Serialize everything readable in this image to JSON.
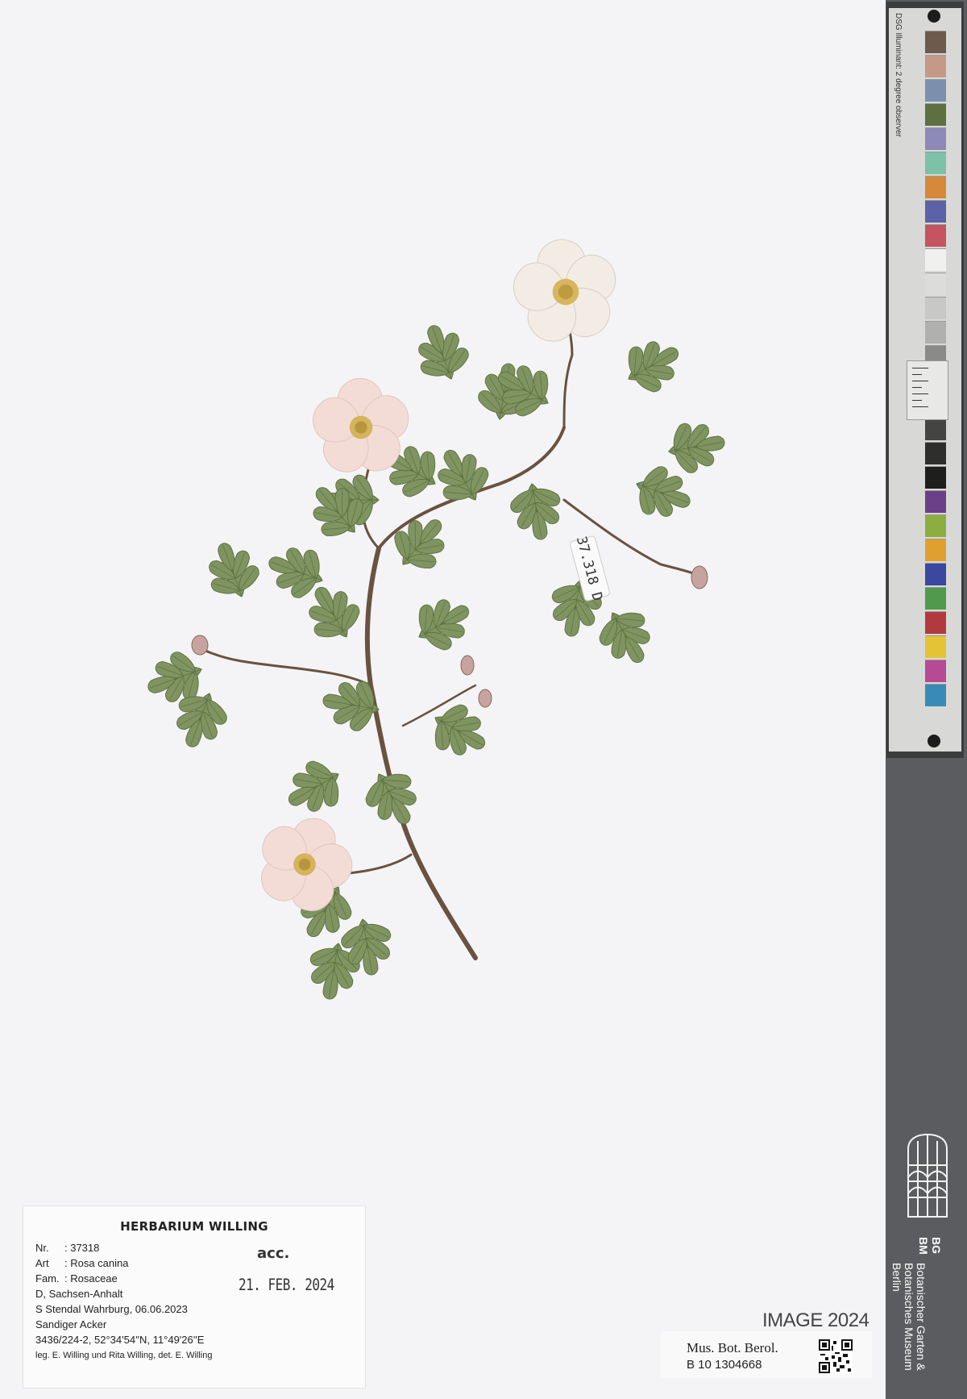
{
  "specimen_label": {
    "heading": "HERBARIUM WILLING",
    "nr_key": "Nr.",
    "nr_value": ": 37318",
    "art_key": "Art",
    "art_value": ": Rosa canina",
    "fam_key": "Fam.",
    "fam_value": ": Rosaceae",
    "region": "D,  Sachsen-Anhalt",
    "locality": "S Stendal Wahrburg, 06.06.2023",
    "habitat": "Sandiger Acker",
    "coordinates": "3436/224-2, 52°34'54''N, 11°49'26''E",
    "collectors": "leg. E. Willing und Rita Willing,  det.  E. Willing"
  },
  "stamp": {
    "acc": "acc.",
    "date": "21. FEB. 2024"
  },
  "specimen_tag": "37.318 D",
  "image_year": "IMAGE 2024",
  "museum": {
    "line1": "Mus. Bot. Berol.",
    "line2": "B 10 1304668"
  },
  "institution": {
    "abbr_top": "BG",
    "abbr_bottom": "BM",
    "name_line1": "Botanischer Garten &",
    "name_line2": "Botanisches Museum",
    "name_line3": "Berlin"
  },
  "color_card": {
    "header": "DSG Illuminant: 2 degree observer",
    "patch_colors": [
      "#6e5a4c",
      "#c49a86",
      "#7b8fae",
      "#5e7042",
      "#8d89b8",
      "#7cc1a8",
      "#d6893a",
      "#5b62a8",
      "#c4545f",
      "#f0f0ee",
      "#dcdcda",
      "#c8c8c6",
      "#b0b0ae",
      "#8a8a88",
      "#6b6b69",
      "#575755",
      "#444442",
      "#2e2e2c",
      "#1e1e1c",
      "#6b3f8a",
      "#8cae40",
      "#e0a030",
      "#3b48a0",
      "#4f9a4c",
      "#b03a3f",
      "#e4c434",
      "#b64a94",
      "#3a8ab8"
    ]
  }
}
